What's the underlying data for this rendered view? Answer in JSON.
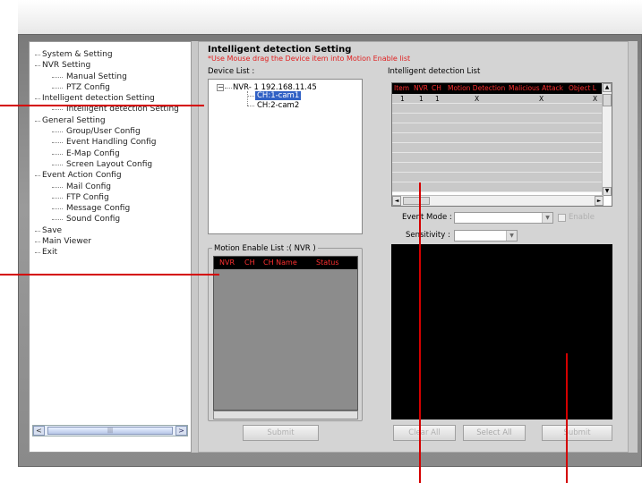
{
  "tree": {
    "items": [
      {
        "label": "System & Setting",
        "level": 0
      },
      {
        "label": "NVR  Setting",
        "level": 0
      },
      {
        "label": "Manual Setting",
        "level": 1
      },
      {
        "label": "PTZ Config",
        "level": 1
      },
      {
        "label": "Intelligent detection Setting",
        "level": 0
      },
      {
        "label": "Intelligent detection Setting",
        "level": 1
      },
      {
        "label": "General Setting",
        "level": 0
      },
      {
        "label": "Group/User Config",
        "level": 1
      },
      {
        "label": "Event Handling Config",
        "level": 1
      },
      {
        "label": "E-Map Config",
        "level": 1
      },
      {
        "label": "Screen Layout Config",
        "level": 1
      },
      {
        "label": "Event Action Config",
        "level": 0
      },
      {
        "label": "Mail Config",
        "level": 1
      },
      {
        "label": "FTP Config",
        "level": 1
      },
      {
        "label": "Message Config",
        "level": 1
      },
      {
        "label": "Sound Config",
        "level": 1
      },
      {
        "label": "Save",
        "level": 0
      },
      {
        "label": "Main Viewer",
        "level": 0
      },
      {
        "label": "Exit",
        "level": 0
      }
    ],
    "scroll_left": "<",
    "scroll_right": ">"
  },
  "panel": {
    "title": "Intelligent detection Setting",
    "hint": "*Use Mouse drag the Device item into Motion Enable list"
  },
  "device_list": {
    "label": "Device List :",
    "nvr_node": "NVR- 1 192.168.11.45",
    "cameras": [
      "CH:1-cam1",
      "CH:2-cam2"
    ],
    "selected": "CH:1-cam1"
  },
  "motion": {
    "legend": "Motion Enable List :( NVR )",
    "columns": [
      "NVR",
      "CH",
      "CH Name",
      "Status"
    ],
    "submit": "Submit"
  },
  "detection": {
    "label": "Intelligent detection List",
    "columns": [
      "Item",
      "NVR",
      "CH",
      "Motion Detection",
      "Malicious Attack",
      "Object L"
    ],
    "rows": [
      [
        "1",
        "1",
        "1",
        "X",
        "X",
        "X"
      ]
    ],
    "event_mode_label": "Event Mode :",
    "enable_label": "Enable",
    "sensitivity_label": "Sensitivity :",
    "clear_all": "Clear All",
    "select_all": "Select All",
    "submit": "Submit"
  },
  "colors": {
    "callout": "#d40000",
    "header_bg": "#000000",
    "header_text": "#ff3030",
    "selection": "#3161c5"
  }
}
